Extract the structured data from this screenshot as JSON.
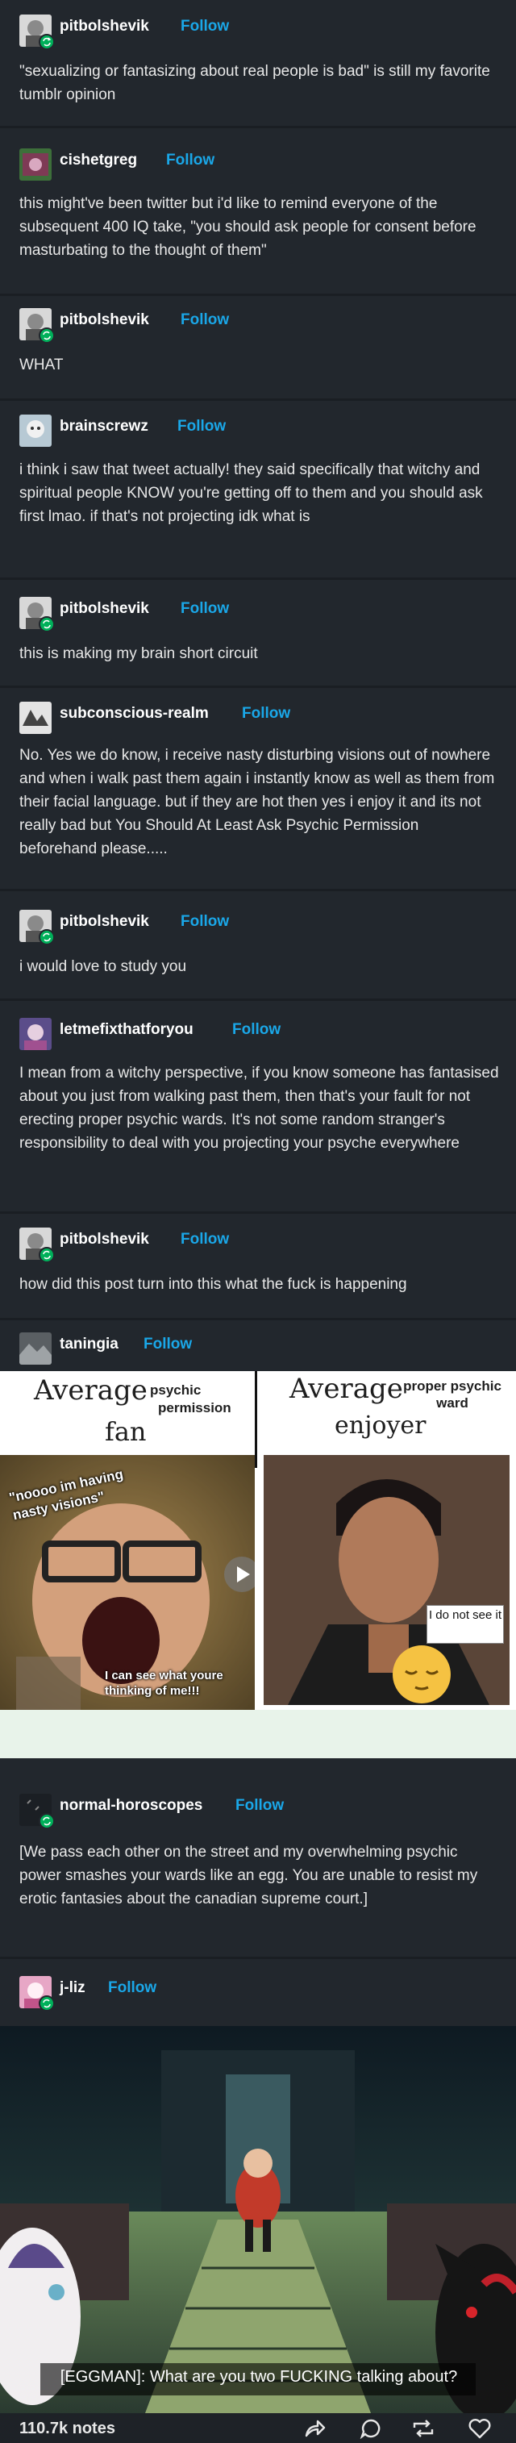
{
  "follow_label": "Follow",
  "posts": [
    {
      "user": "pitbolshevik",
      "text": "\"sexualizing or fantasizing about real people is bad\" is still my favorite tumblr opinion"
    },
    {
      "user": "cishetgreg",
      "text": "this might've been twitter but i'd like to remind everyone of the subsequent 400 IQ take, \"you should ask people for consent before masturbating to the thought of them\""
    },
    {
      "user": "pitbolshevik",
      "text": "WHAT"
    },
    {
      "user": "brainscrewz",
      "text": "i think i saw that tweet actually! they said specifically that witchy and spiritual people KNOW you're getting off to them and you should ask first lmao. if that's not projecting idk what is"
    },
    {
      "user": "pitbolshevik",
      "text": "this is making my brain short circuit"
    },
    {
      "user": "subconscious-realm",
      "text": "No. Yes we do know, i receive nasty disturbing visions out of nowhere and when i walk past them again i instantly know as well as them from their facial language. but if they are hot then yes i enjoy it and its not really bad but You Should At Least Ask Psychic Permission beforehand please....."
    },
    {
      "user": "pitbolshevik",
      "text": "i would love to study you"
    },
    {
      "user": "letmefixthatforyou",
      "text": "I mean from a witchy perspective, if you know someone has fantasised about you just from walking past them, then that's your fault for not erecting proper psychic wards.  It's not some random stranger's responsibility to deal with you projecting your psyche everywhere"
    },
    {
      "user": "pitbolshevik",
      "text": "how did this post turn into this what the fuck is happening"
    },
    {
      "user": "taningia",
      "text": ""
    },
    {
      "user": "normal-horoscopes",
      "text": "[We pass each other on the street and my overwhelming psychic power smashes your wards like an egg. You are unable to resist my erotic fantasies about the canadian supreme court.]"
    },
    {
      "user": "j-liz",
      "text": ""
    }
  ],
  "meme": {
    "left_title": "Average",
    "left_sub1": "psychic",
    "left_sub2": "permission",
    "left_fan": "fan",
    "left_caption_top": "\"noooo im having nasty visions\"",
    "left_caption_bottom": "I can see what youre thinking of me!!!",
    "right_title": "Average",
    "right_sub": "proper psychic ward",
    "right_enjoyer": "enjoyer",
    "right_bubble": "I do not see it"
  },
  "sonic_caption": "[EGGMAN]: What are you two FUCKING talking about?",
  "footer": {
    "notes": "110.7k notes"
  },
  "colors": {
    "background": "#22272d",
    "follow": "#1aa7e8",
    "reblog_badge": "#00b05a"
  }
}
